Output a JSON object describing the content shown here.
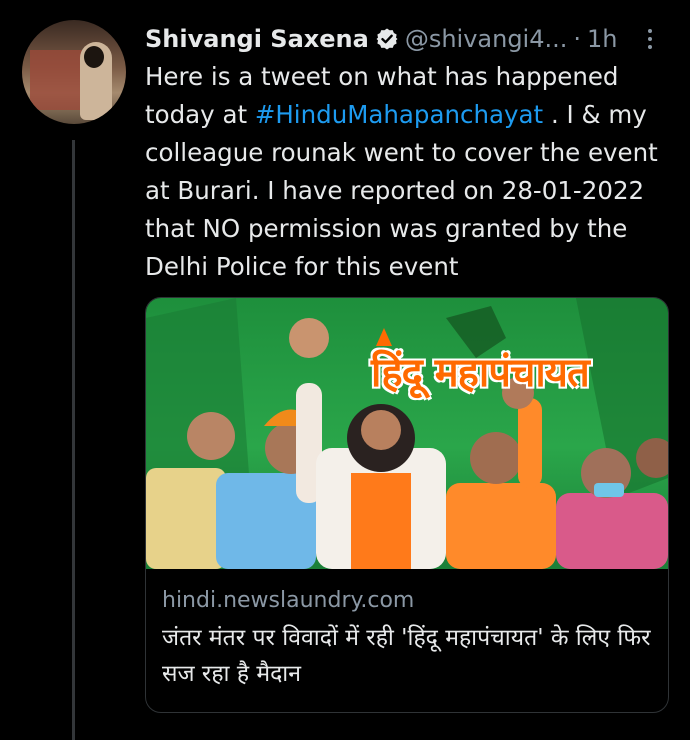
{
  "author": {
    "name": "Shivangi Saxena",
    "handle": "@shivangi4...",
    "separator": "·",
    "time": "1h"
  },
  "tweet": {
    "text_before": "Here is a tweet on what has happened today at ",
    "hashtag": "#HinduMahapanchayat",
    "text_after": " . I & my colleague rounak went to cover the event at Burari. I have reported on 28-01-2022 that NO permission was granted by the Delhi Police for this event"
  },
  "card": {
    "image_title": "हिंदू महापंचायत",
    "domain": "hindi.newslaundry.com",
    "headline": "जंतर मंतर पर विवादों में रही 'हिंदू महापंचायत' के लिए फिर सज रहा है मैदान"
  },
  "colors": {
    "background": "#000000",
    "text": "#e7e9ea",
    "muted": "#8b98a5",
    "link": "#1d9bf0",
    "card_green": "#2aa64a",
    "title_orange": "#ff6a00"
  },
  "icons": [
    "verified-badge-icon",
    "more-options-icon"
  ]
}
